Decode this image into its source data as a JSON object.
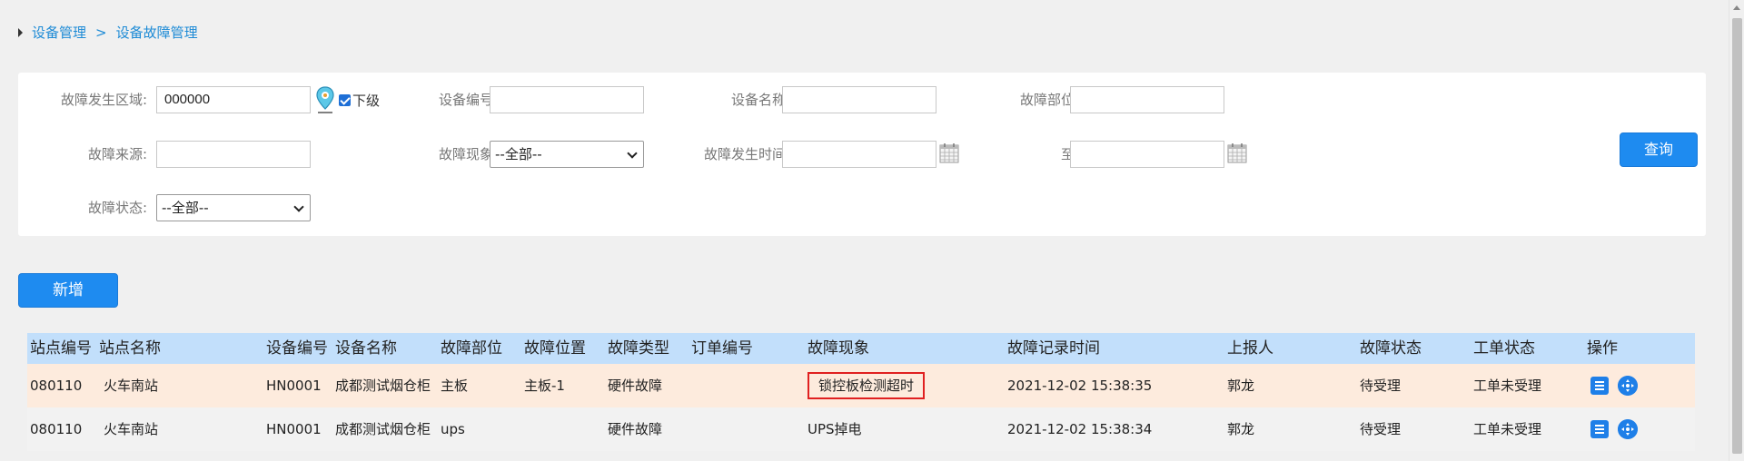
{
  "breadcrumb": {
    "parent": "设备管理",
    "separator": ">",
    "current": "设备故障管理"
  },
  "filters": {
    "fault_area": {
      "label": "故障发生区域:",
      "value": "000000"
    },
    "include_sub": {
      "label": "下级",
      "checked": true
    },
    "device_no": {
      "label": "设备编号:",
      "value": ""
    },
    "device_name": {
      "label": "设备名称:",
      "value": ""
    },
    "fault_part": {
      "label": "故障部位:",
      "value": ""
    },
    "fault_source": {
      "label": "故障来源:",
      "value": ""
    },
    "fault_phenomenon": {
      "label": "故障现象:",
      "selected": "--全部--"
    },
    "fault_time": {
      "label": "故障发生时间:",
      "value": ""
    },
    "to": {
      "label": "至:",
      "value": ""
    },
    "fault_status": {
      "label": "故障状态:",
      "selected": "--全部--"
    },
    "query_button": "查询"
  },
  "toolbar": {
    "add_button": "新增"
  },
  "table": {
    "columns": [
      "站点编号",
      "站点名称",
      "设备编号",
      "设备名称",
      "故障部位",
      "故障位置",
      "故障类型",
      "订单编号",
      "故障现象",
      "故障记录时间",
      "上报人",
      "故障状态",
      "工单状态",
      "操作"
    ],
    "rows": [
      {
        "station_no": "080110",
        "station_name": "火车南站",
        "device_no": "HN0001",
        "device_name": "成都测试烟仓柜",
        "fault_part": "主板",
        "fault_position": "主板-1",
        "fault_type": "硬件故障",
        "order_no": "",
        "phenomenon": "锁控板检测超时",
        "record_time": "2021-12-02 15:38:35",
        "reporter": "郭龙",
        "fault_status": "待受理",
        "ticket_status": "工单未受理"
      },
      {
        "station_no": "080110",
        "station_name": "火车南站",
        "device_no": "HN0001",
        "device_name": "成都测试烟仓柜",
        "fault_part": "ups",
        "fault_position": "",
        "fault_type": "硬件故障",
        "order_no": "",
        "phenomenon": "UPS掉电",
        "record_time": "2021-12-02 15:38:34",
        "reporter": "郭龙",
        "fault_status": "待受理",
        "ticket_status": "工单未受理"
      }
    ]
  },
  "icons": {
    "location": "location-pin-icon",
    "calendar": "calendar-icon",
    "detail": "list-icon",
    "move": "move-icon"
  },
  "colors": {
    "accent": "#1e8bf0",
    "header_bg": "#c2dffb",
    "highlight_row": "#fdebdd",
    "alt_row": "#f2f2f2",
    "highlight_border": "#e02020"
  }
}
